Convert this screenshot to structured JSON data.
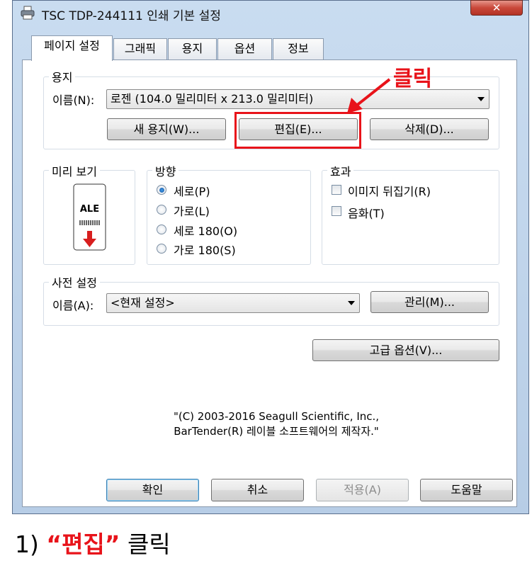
{
  "window": {
    "title": "TSC TDP-244111 인쇄 기본 설정",
    "close_label": "✕"
  },
  "tabs": [
    {
      "label": "페이지 설정"
    },
    {
      "label": "그래픽"
    },
    {
      "label": "용지"
    },
    {
      "label": "옵션"
    },
    {
      "label": "정보"
    }
  ],
  "paper": {
    "group_title": "용지",
    "name_label": "이름(N):",
    "name_value": "로젠 (104.0 밀리미터 x 213.0 밀리미터)",
    "new_button": "새 용지(W)...",
    "edit_button": "편집(E)...",
    "delete_button": "삭제(D)..."
  },
  "preview": {
    "group_title": "미리 보기",
    "label_text": "ALE"
  },
  "orientation": {
    "group_title": "방향",
    "options": [
      {
        "label": "세로(P)",
        "selected": true
      },
      {
        "label": "가로(L)",
        "selected": false
      },
      {
        "label": "세로 180(O)",
        "selected": false
      },
      {
        "label": "가로 180(S)",
        "selected": false
      }
    ]
  },
  "effects": {
    "group_title": "효과",
    "options": [
      {
        "label": "이미지 뒤집기(R)",
        "checked": false
      },
      {
        "label": "음화(T)",
        "checked": false
      }
    ]
  },
  "preset": {
    "group_title": "사전 설정",
    "name_label": "이름(A):",
    "name_value": "<현재 설정>",
    "manage_button": "관리(M)..."
  },
  "advanced_button": "고급 옵션(V)...",
  "copyright": {
    "line1": "\"(C) 2003-2016 Seagull Scientific, Inc.,",
    "line2": "BarTender(R) 레이블 소프트웨어의 제작자.\""
  },
  "footer": {
    "ok": "확인",
    "cancel": "취소",
    "apply": "적용(A)",
    "help": "도움말"
  },
  "annotation": {
    "text": "클릭",
    "color": "#e8131a"
  },
  "caption": {
    "prefix": "1) ",
    "quoted": "“편집”",
    "suffix": " 클릭"
  }
}
